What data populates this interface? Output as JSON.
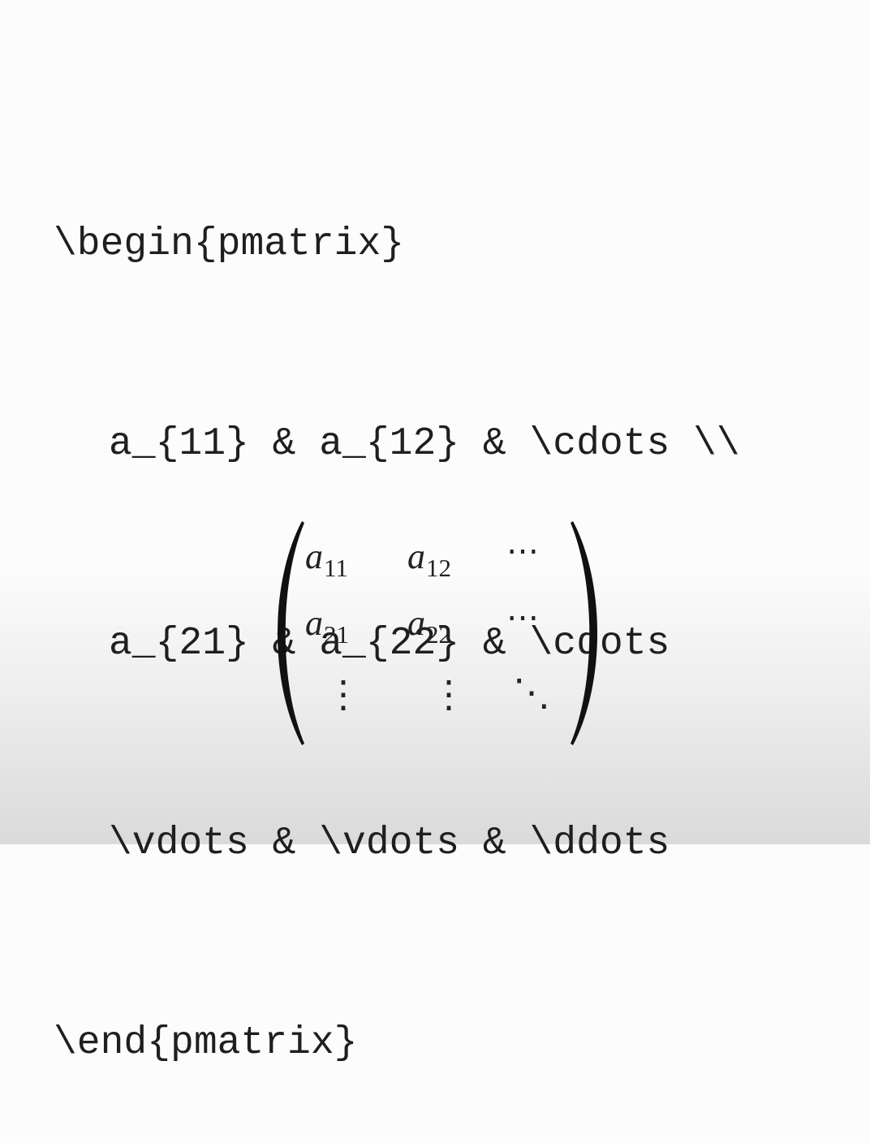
{
  "code": {
    "lines": [
      "\\begin{pmatrix}",
      "a_{11} & a_{12} & \\cdots \\\\",
      "a_{21} & a_{22} & \\cdots",
      "\\vdots & \\vdots & \\ddots",
      "\\end{pmatrix}"
    ]
  },
  "matrix": {
    "rows": [
      [
        {
          "var": "a",
          "sub": "11"
        },
        {
          "var": "a",
          "sub": "12"
        },
        "⋯"
      ],
      [
        {
          "var": "a",
          "sub": "21"
        },
        {
          "var": "a",
          "sub": "22"
        },
        "⋯"
      ],
      [
        "⋮",
        "⋮",
        "⋱"
      ]
    ],
    "a11_var": "a",
    "a11_sub": "11",
    "a12_var": "a",
    "a12_sub": "12",
    "a21_var": "a",
    "a21_sub": "21",
    "a22_var": "a",
    "a22_sub": "22"
  }
}
